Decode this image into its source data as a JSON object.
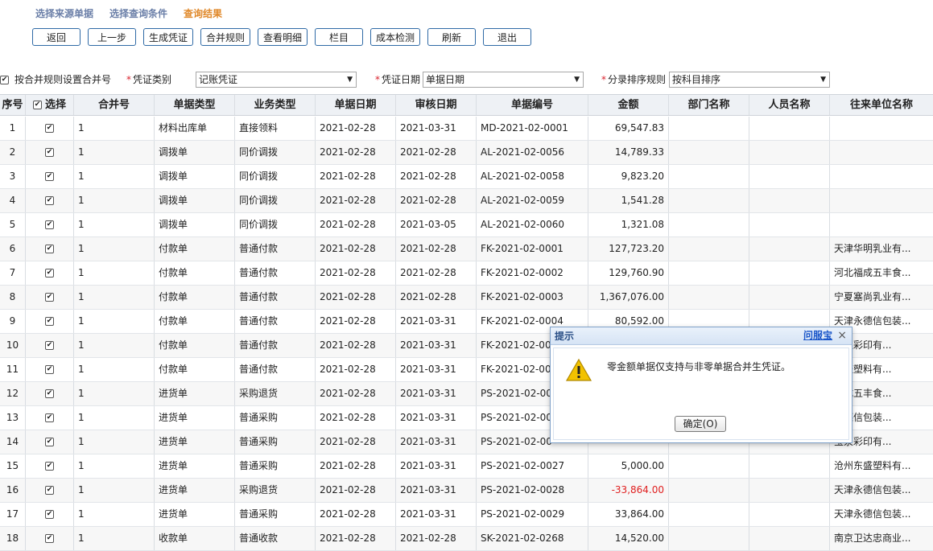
{
  "steps": [
    "选择来源单据",
    "选择查询条件",
    "查询结果"
  ],
  "toolbar": [
    "返回",
    "上一步",
    "生成凭证",
    "合并规则",
    "查看明细",
    "栏目",
    "成本检测",
    "刷新",
    "退出"
  ],
  "filters": {
    "merge_by_rule_label": "按合并规则设置合并号",
    "voucher_type_label": "凭证类别",
    "voucher_type_value": "记账凭证",
    "voucher_date_label": "凭证日期",
    "voucher_date_value": "单据日期",
    "sort_rule_label": "分录排序规则",
    "sort_rule_value": "按科目排序"
  },
  "columns": [
    "序号",
    "选择",
    "合并号",
    "单据类型",
    "业务类型",
    "单据日期",
    "审核日期",
    "单据编号",
    "金额",
    "部门名称",
    "人员名称",
    "往来单位名称"
  ],
  "rows": [
    {
      "no": "1",
      "merge": "1",
      "doc_type": "材料出库单",
      "biz_type": "直接领料",
      "doc_date": "2021-02-28",
      "audit_date": "2021-03-31",
      "doc_no": "MD-2021-02-0001",
      "amount": "69,547.83",
      "dept": "",
      "person": "",
      "partner": ""
    },
    {
      "no": "2",
      "merge": "1",
      "doc_type": "调拨单",
      "biz_type": "同价调拨",
      "doc_date": "2021-02-28",
      "audit_date": "2021-02-28",
      "doc_no": "AL-2021-02-0056",
      "amount": "14,789.33",
      "dept": "",
      "person": "",
      "partner": ""
    },
    {
      "no": "3",
      "merge": "1",
      "doc_type": "调拨单",
      "biz_type": "同价调拨",
      "doc_date": "2021-02-28",
      "audit_date": "2021-02-28",
      "doc_no": "AL-2021-02-0058",
      "amount": "9,823.20",
      "dept": "",
      "person": "",
      "partner": ""
    },
    {
      "no": "4",
      "merge": "1",
      "doc_type": "调拨单",
      "biz_type": "同价调拨",
      "doc_date": "2021-02-28",
      "audit_date": "2021-02-28",
      "doc_no": "AL-2021-02-0059",
      "amount": "1,541.28",
      "dept": "",
      "person": "",
      "partner": ""
    },
    {
      "no": "5",
      "merge": "1",
      "doc_type": "调拨单",
      "biz_type": "同价调拨",
      "doc_date": "2021-02-28",
      "audit_date": "2021-03-05",
      "doc_no": "AL-2021-02-0060",
      "amount": "1,321.08",
      "dept": "",
      "person": "",
      "partner": ""
    },
    {
      "no": "6",
      "merge": "1",
      "doc_type": "付款单",
      "biz_type": "普通付款",
      "doc_date": "2021-02-28",
      "audit_date": "2021-02-28",
      "doc_no": "FK-2021-02-0001",
      "amount": "127,723.20",
      "dept": "",
      "person": "",
      "partner": "天津华明乳业有..."
    },
    {
      "no": "7",
      "merge": "1",
      "doc_type": "付款单",
      "biz_type": "普通付款",
      "doc_date": "2021-02-28",
      "audit_date": "2021-02-28",
      "doc_no": "FK-2021-02-0002",
      "amount": "129,760.90",
      "dept": "",
      "person": "",
      "partner": "河北福成五丰食..."
    },
    {
      "no": "8",
      "merge": "1",
      "doc_type": "付款单",
      "biz_type": "普通付款",
      "doc_date": "2021-02-28",
      "audit_date": "2021-02-28",
      "doc_no": "FK-2021-02-0003",
      "amount": "1,367,076.00",
      "dept": "",
      "person": "",
      "partner": "宁夏塞尚乳业有..."
    },
    {
      "no": "9",
      "merge": "1",
      "doc_type": "付款单",
      "biz_type": "普通付款",
      "doc_date": "2021-02-28",
      "audit_date": "2021-03-31",
      "doc_no": "FK-2021-02-0004",
      "amount": "80,592.00",
      "dept": "",
      "person": "",
      "partner": "天津永德信包装..."
    },
    {
      "no": "10",
      "merge": "1",
      "doc_type": "付款单",
      "biz_type": "普通付款",
      "doc_date": "2021-02-28",
      "audit_date": "2021-03-31",
      "doc_no": "FK-2021-02-00",
      "amount": "",
      "dept": "",
      "person": "",
      "partner": "宝泉彩印有..."
    },
    {
      "no": "11",
      "merge": "1",
      "doc_type": "付款单",
      "biz_type": "普通付款",
      "doc_date": "2021-02-28",
      "audit_date": "2021-03-31",
      "doc_no": "FK-2021-02-00",
      "amount": "",
      "dept": "",
      "person": "",
      "partner": "东盛塑料有..."
    },
    {
      "no": "12",
      "merge": "1",
      "doc_type": "进货单",
      "biz_type": "采购退货",
      "doc_date": "2021-02-28",
      "audit_date": "2021-03-31",
      "doc_no": "PS-2021-02-00",
      "amount": "",
      "dept": "",
      "person": "",
      "partner": "福成五丰食..."
    },
    {
      "no": "13",
      "merge": "1",
      "doc_type": "进货单",
      "biz_type": "普通采购",
      "doc_date": "2021-02-28",
      "audit_date": "2021-03-31",
      "doc_no": "PS-2021-02-00",
      "amount": "",
      "dept": "",
      "person": "",
      "partner": "永德信包装..."
    },
    {
      "no": "14",
      "merge": "1",
      "doc_type": "进货单",
      "biz_type": "普通采购",
      "doc_date": "2021-02-28",
      "audit_date": "2021-03-31",
      "doc_no": "PS-2021-02-00",
      "amount": "",
      "dept": "",
      "person": "",
      "partner": "宝泉彩印有..."
    },
    {
      "no": "15",
      "merge": "1",
      "doc_type": "进货单",
      "biz_type": "普通采购",
      "doc_date": "2021-02-28",
      "audit_date": "2021-03-31",
      "doc_no": "PS-2021-02-0027",
      "amount": "5,000.00",
      "dept": "",
      "person": "",
      "partner": "沧州东盛塑料有..."
    },
    {
      "no": "16",
      "merge": "1",
      "doc_type": "进货单",
      "biz_type": "采购退货",
      "doc_date": "2021-02-28",
      "audit_date": "2021-03-31",
      "doc_no": "PS-2021-02-0028",
      "amount": "-33,864.00",
      "dept": "",
      "person": "",
      "partner": "天津永德信包装..."
    },
    {
      "no": "17",
      "merge": "1",
      "doc_type": "进货单",
      "biz_type": "普通采购",
      "doc_date": "2021-02-28",
      "audit_date": "2021-03-31",
      "doc_no": "PS-2021-02-0029",
      "amount": "33,864.00",
      "dept": "",
      "person": "",
      "partner": "天津永德信包装..."
    },
    {
      "no": "18",
      "merge": "1",
      "doc_type": "收款单",
      "biz_type": "普通收款",
      "doc_date": "2021-02-28",
      "audit_date": "2021-02-28",
      "doc_no": "SK-2021-02-0268",
      "amount": "14,520.00",
      "dept": "",
      "person": "",
      "partner": "南京卫达忠商业..."
    }
  ],
  "dialog": {
    "title": "提示",
    "help": "问服宝",
    "close": "×",
    "message": "零金额单据仅支持与非零单据合并生凭证。",
    "ok": "确定(O)"
  },
  "colors": {
    "step_active": "#e0892b",
    "step_inactive": "#6b7fa8",
    "negative_amount": "#e02020",
    "warning_icon": "#f2c200"
  }
}
